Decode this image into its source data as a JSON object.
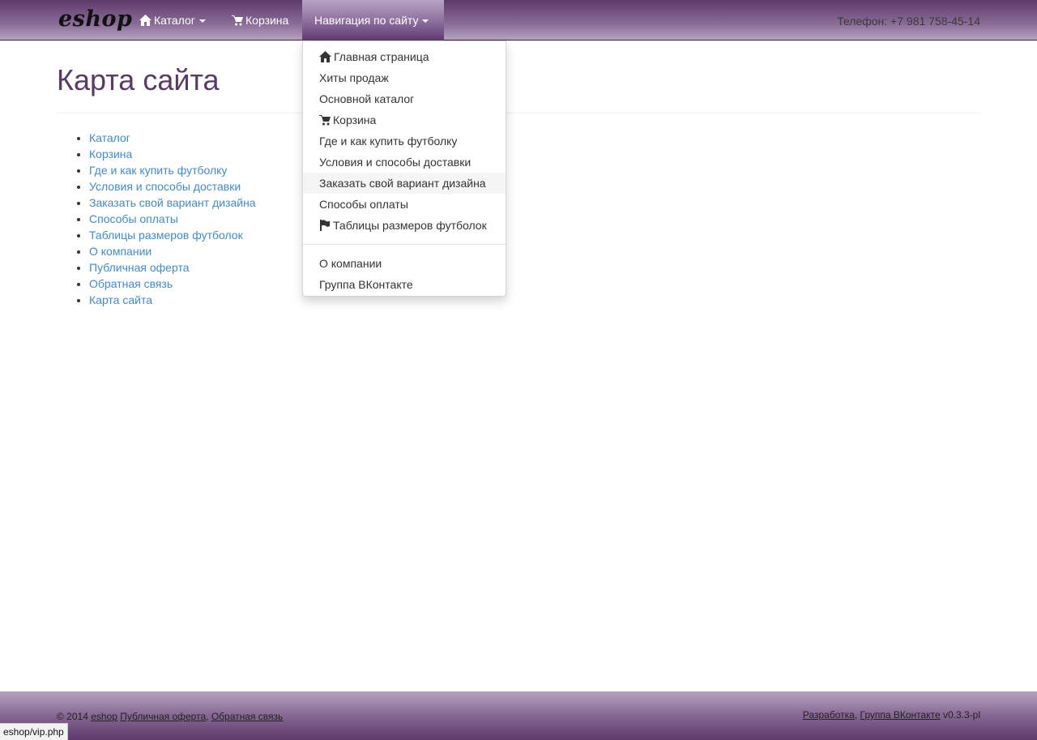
{
  "navbar": {
    "brand": "eshop",
    "catalog": {
      "label": "Каталог",
      "icon": "home-icon"
    },
    "cart": {
      "label": "Корзина",
      "icon": "cart-icon"
    },
    "site_nav": {
      "label": "Навигация по сайту"
    },
    "phone": "Телефон: +7 981 758-45-14"
  },
  "dropdown": {
    "items": [
      {
        "label": "Главная страница",
        "icon": "home-icon"
      },
      {
        "label": "Хиты продаж"
      },
      {
        "label": "Основной каталог"
      },
      {
        "label": "Корзина",
        "icon": "cart-icon"
      },
      {
        "label": "Где и как купить футболку"
      },
      {
        "label": "Условия и способы доставки"
      },
      {
        "label": "Заказать свой вариант дизайна"
      },
      {
        "label": "Способы оплаты"
      },
      {
        "label": "Таблицы размеров футболок",
        "icon": "flag-icon"
      }
    ],
    "extra_items": [
      {
        "label": "О компании"
      },
      {
        "label": "Группа ВКонтакте"
      }
    ]
  },
  "page": {
    "title": "Карта сайта",
    "links": [
      "Каталог",
      "Корзина",
      "Где и как купить футболку",
      "Условия и способы доставки",
      "Заказать свой вариант дизайна",
      "Способы оплаты",
      "Таблицы размеров футболок",
      "О компании",
      "Публичная оферта",
      "Обратная связь",
      "Карта сайта"
    ]
  },
  "footer": {
    "copyright": "© 2014",
    "brand_link": "eshop",
    "offer_link": "Публичная оферта",
    "feedback_link": "Обратная связь",
    "dev_link": "Разработка",
    "vk_link": "Группа ВКонтакте",
    "version": "v0.3.3-pl"
  },
  "statusbar": {
    "url": "eshop/vip.php"
  },
  "colors": {
    "navbar_dark": "#5d3a6b",
    "navbar_light": "#b5a3bf",
    "title": "#5a3a67",
    "link": "#428bca"
  }
}
